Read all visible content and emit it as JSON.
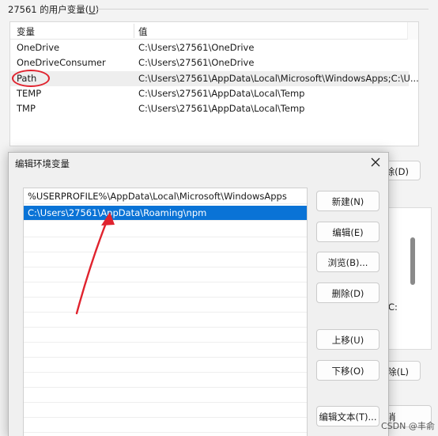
{
  "background": {
    "group_title_prefix": "27561 的用户变量(",
    "group_title_key": "U",
    "group_title_suffix": ")",
    "table": {
      "col_variable": "变量",
      "col_value": "值",
      "rows": [
        {
          "name": "OneDrive",
          "value": "C:\\Users\\27561\\OneDrive"
        },
        {
          "name": "OneDriveConsumer",
          "value": "C:\\Users\\27561\\OneDrive"
        },
        {
          "name": "Path",
          "value": "C:\\Users\\27561\\AppData\\Local\\Microsoft\\WindowsApps;C:\\U..."
        },
        {
          "name": "TEMP",
          "value": "C:\\Users\\27561\\AppData\\Local\\Temp"
        },
        {
          "name": "TMP",
          "value": "C:\\Users\\27561\\AppData\\Local\\Temp"
        }
      ]
    },
    "btn_delete_partial": "除(D)",
    "btn_delete2_partial": "除(L)",
    "c_partial": "C:",
    "cancel_partial": "消"
  },
  "dialog": {
    "title": "编辑环境变量",
    "entries": [
      "%USERPROFILE%\\AppData\\Local\\Microsoft\\WindowsApps",
      "C:\\Users\\27561\\AppData\\Roaming\\npm"
    ],
    "buttons": {
      "new": "新建(N)",
      "edit": "编辑(E)",
      "browse": "浏览(B)...",
      "delete": "删除(D)",
      "move_up": "上移(U)",
      "move_down": "下移(O)",
      "edit_text": "编辑文本(T)..."
    }
  },
  "watermark": "CSDN @丰俞 ~",
  "colors": {
    "selection": "#0a73d6",
    "annotation": "#e0232e"
  }
}
